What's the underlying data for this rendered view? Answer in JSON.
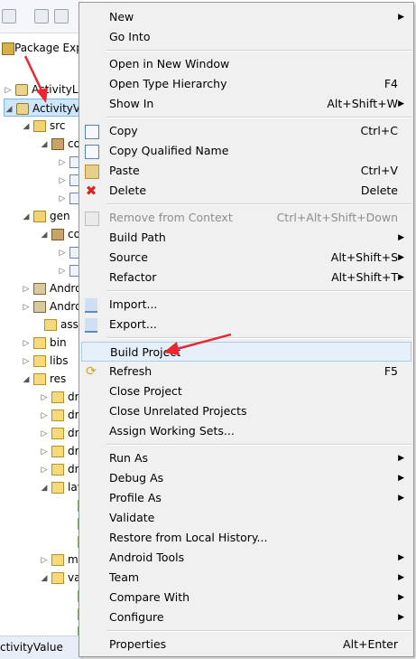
{
  "explorer": {
    "title": "Package Exp",
    "rows": [
      {
        "label": "ActivityLi",
        "icon": "project-icon",
        "twisty": "▷"
      },
      {
        "label": "ActivityV",
        "icon": "project-icon",
        "twisty": "◢"
      },
      {
        "label": "src",
        "icon": "source-folder-icon",
        "twisty": "◢"
      },
      {
        "label": "co",
        "icon": "package-icon",
        "twisty": "◢"
      },
      {
        "label": "",
        "icon": "java-file-icon",
        "twisty": "▷"
      },
      {
        "label": "",
        "icon": "java-file-icon",
        "twisty": "▷"
      },
      {
        "label": "",
        "icon": "java-file-icon",
        "twisty": "▷"
      },
      {
        "label": "gen",
        "icon": "source-folder-icon",
        "twisty": "◢"
      },
      {
        "label": "co",
        "icon": "package-icon",
        "twisty": "◢"
      },
      {
        "label": "",
        "icon": "java-file-icon",
        "twisty": "▷"
      },
      {
        "label": "",
        "icon": "java-file-icon",
        "twisty": "▷"
      },
      {
        "label": "Andro",
        "icon": "library-icon",
        "twisty": "▷"
      },
      {
        "label": "Andro",
        "icon": "library-icon",
        "twisty": "▷"
      },
      {
        "label": "asset",
        "icon": "folder-icon",
        "twisty": ""
      },
      {
        "label": "bin",
        "icon": "folder-icon",
        "twisty": "▷"
      },
      {
        "label": "libs",
        "icon": "folder-icon",
        "twisty": "▷"
      },
      {
        "label": "res",
        "icon": "folder-icon",
        "twisty": "◢"
      },
      {
        "label": "dr",
        "icon": "folder-icon",
        "twisty": "▷"
      },
      {
        "label": "dr",
        "icon": "folder-icon",
        "twisty": "▷"
      },
      {
        "label": "dr",
        "icon": "folder-icon",
        "twisty": "▷"
      },
      {
        "label": "dr",
        "icon": "folder-icon",
        "twisty": "▷"
      },
      {
        "label": "dr",
        "icon": "folder-icon",
        "twisty": "▷"
      },
      {
        "label": "lay",
        "icon": "folder-icon",
        "twisty": "◢"
      },
      {
        "label": "",
        "icon": "xml-file-icon",
        "twisty": ""
      },
      {
        "label": "",
        "icon": "xml-file-icon",
        "twisty": ""
      },
      {
        "label": "",
        "icon": "xml-file-icon",
        "twisty": ""
      },
      {
        "label": "m",
        "icon": "folder-icon",
        "twisty": "▷"
      },
      {
        "label": "va",
        "icon": "folder-icon",
        "twisty": "◢"
      },
      {
        "label": "",
        "icon": "xml-file-icon",
        "twisty": ""
      },
      {
        "label": "",
        "icon": "xml-file-icon",
        "twisty": ""
      },
      {
        "label": "",
        "icon": "xml-file-icon",
        "twisty": ""
      }
    ],
    "selected_row": "ActivityV",
    "status_text": "ctivityValue"
  },
  "context_menu": {
    "items": [
      {
        "label": "New",
        "accel": "",
        "submenu": true,
        "icon": ""
      },
      {
        "label": "Go Into",
        "accel": "",
        "submenu": false,
        "icon": ""
      },
      {
        "label": "Open in New Window",
        "accel": "",
        "submenu": false,
        "icon": ""
      },
      {
        "label": "Open Type Hierarchy",
        "accel": "F4",
        "submenu": false,
        "icon": ""
      },
      {
        "label": "Show In",
        "accel": "Alt+Shift+W",
        "submenu": true,
        "icon": ""
      },
      {
        "label": "Copy",
        "accel": "Ctrl+C",
        "submenu": false,
        "icon": "copy-icon"
      },
      {
        "label": "Copy Qualified Name",
        "accel": "",
        "submenu": false,
        "icon": "copy-qualified-name-icon"
      },
      {
        "label": "Paste",
        "accel": "Ctrl+V",
        "submenu": false,
        "icon": "paste-icon"
      },
      {
        "label": "Delete",
        "accel": "Delete",
        "submenu": false,
        "icon": "delete-icon"
      },
      {
        "label": "Remove from Context",
        "accel": "Ctrl+Alt+Shift+Down",
        "submenu": false,
        "icon": "remove-from-context-icon",
        "disabled": true
      },
      {
        "label": "Build Path",
        "accel": "",
        "submenu": true,
        "icon": ""
      },
      {
        "label": "Source",
        "accel": "Alt+Shift+S",
        "submenu": true,
        "icon": ""
      },
      {
        "label": "Refactor",
        "accel": "Alt+Shift+T",
        "submenu": true,
        "icon": ""
      },
      {
        "label": "Import...",
        "accel": "",
        "submenu": false,
        "icon": "import-icon"
      },
      {
        "label": "Export...",
        "accel": "",
        "submenu": false,
        "icon": "export-icon"
      },
      {
        "label": "Build Project",
        "accel": "",
        "submenu": false,
        "icon": "",
        "highlight": true
      },
      {
        "label": "Refresh",
        "accel": "F5",
        "submenu": false,
        "icon": "refresh-icon"
      },
      {
        "label": "Close Project",
        "accel": "",
        "submenu": false,
        "icon": ""
      },
      {
        "label": "Close Unrelated Projects",
        "accel": "",
        "submenu": false,
        "icon": ""
      },
      {
        "label": "Assign Working Sets...",
        "accel": "",
        "submenu": false,
        "icon": ""
      },
      {
        "label": "Run As",
        "accel": "",
        "submenu": true,
        "icon": ""
      },
      {
        "label": "Debug As",
        "accel": "",
        "submenu": true,
        "icon": ""
      },
      {
        "label": "Profile As",
        "accel": "",
        "submenu": true,
        "icon": ""
      },
      {
        "label": "Validate",
        "accel": "",
        "submenu": false,
        "icon": ""
      },
      {
        "label": "Restore from Local History...",
        "accel": "",
        "submenu": false,
        "icon": ""
      },
      {
        "label": "Android Tools",
        "accel": "",
        "submenu": true,
        "icon": ""
      },
      {
        "label": "Team",
        "accel": "",
        "submenu": true,
        "icon": ""
      },
      {
        "label": "Compare With",
        "accel": "",
        "submenu": true,
        "icon": ""
      },
      {
        "label": "Configure",
        "accel": "",
        "submenu": true,
        "icon": ""
      },
      {
        "label": "Properties",
        "accel": "Alt+Enter",
        "submenu": false,
        "icon": ""
      }
    ],
    "submenu_arrow": "▶"
  },
  "colors": {
    "menu_bg": "#f0f0f0",
    "highlight_bg": "#e5f0fb",
    "selection_bg": "#cde6fb",
    "annotation_red": "#e8272e"
  }
}
